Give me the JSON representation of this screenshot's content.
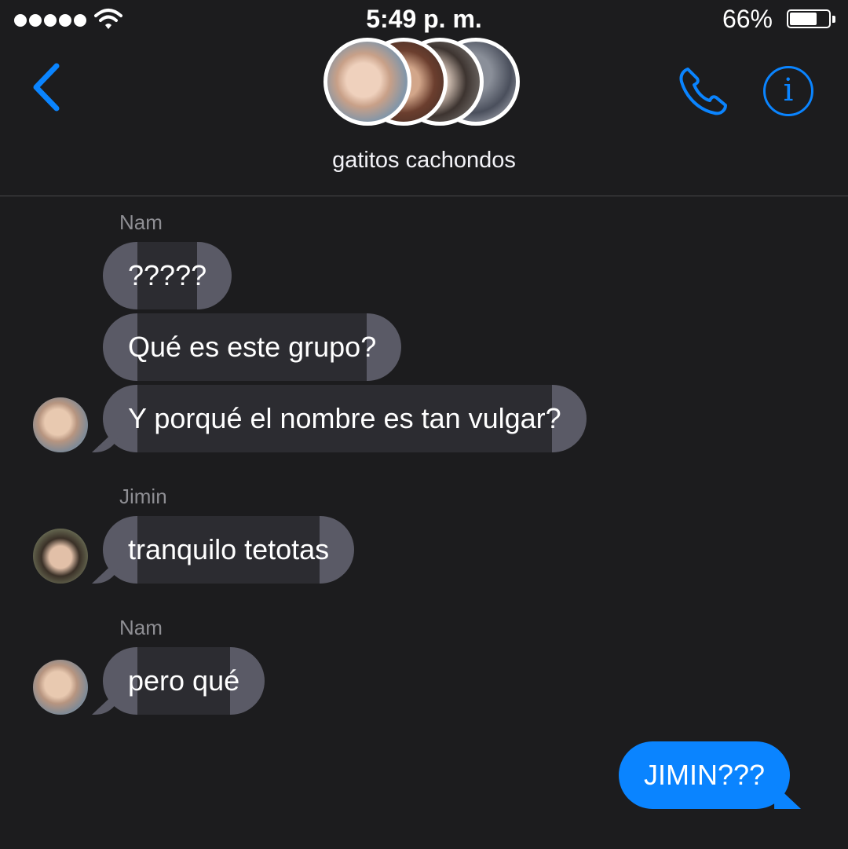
{
  "status_bar": {
    "time": "5:49 p. m.",
    "battery_percent": "66%",
    "battery_level": 0.66,
    "signal_bars": 5
  },
  "header": {
    "group_name": "gatitos cachondos",
    "back_icon": "chevron-left-icon",
    "call_icon": "phone-icon",
    "info_icon": "info-icon",
    "info_glyph": "i",
    "accent_color": "#0a84ff"
  },
  "messages": [
    {
      "sender": "Nam",
      "text": "?????",
      "direction": "incoming"
    },
    {
      "text": "Qué es este grupo?",
      "direction": "incoming"
    },
    {
      "text": "Y porqué el nombre es tan vulgar?",
      "direction": "incoming"
    },
    {
      "sender": "Jimin",
      "text": "tranquilo tetotas",
      "direction": "incoming"
    },
    {
      "sender": "Nam",
      "text": "pero qué",
      "direction": "incoming"
    },
    {
      "text": "JIMIN???",
      "direction": "outgoing"
    }
  ],
  "colors": {
    "background": "#1c1c1e",
    "incoming_bubble": "#5a5a66",
    "outgoing_bubble": "#0a84ff",
    "sender_label": "#8e8e93"
  }
}
